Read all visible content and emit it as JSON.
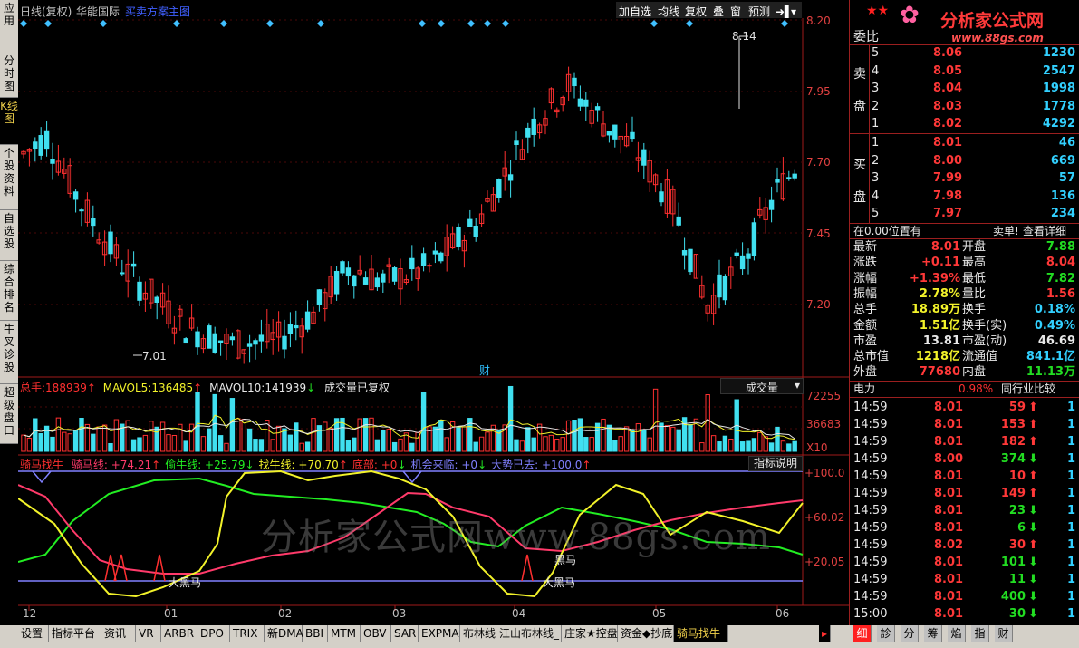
{
  "left_tabs": [
    "应用",
    "分时图",
    "K线图",
    "个股资料",
    "自选股",
    "综合排名",
    "牛叉诊股",
    "超级盘口"
  ],
  "header": {
    "period": "日线(复权)",
    "stock_name": "华能国际",
    "formula": "买卖方案主图",
    "buttons": [
      "加自选",
      "均线",
      "复权",
      "叠",
      "窗",
      "预测"
    ],
    "more_icon": "dropdown-icon"
  },
  "main_chart": {
    "y_ticks": [
      "8.20",
      "7.95",
      "7.70",
      "7.45",
      "7.20"
    ],
    "high_label": "8.14",
    "low_label": "7.01",
    "finance_marker": "财",
    "colors": {
      "up": "#ff3030",
      "down": "#40e0f0",
      "grid": "#7a1010"
    }
  },
  "volume_panel": {
    "total_label": "总手:",
    "total_value": "188939",
    "total_arrow": "↑",
    "mavol5_label": "MAVOL5:",
    "mavol5_value": "136485",
    "mavol5_arrow": "↑",
    "mavol10_label": "MAVOL10:",
    "mavol10_value": "141939",
    "mavol10_arrow": "↓",
    "note": "成交量已复权",
    "selector": "成交量",
    "y_ticks": [
      "72255",
      "36683"
    ],
    "unit": "X10"
  },
  "indicator_panel": {
    "name": "骑马找牛",
    "items": [
      {
        "label": "骑马线:",
        "value": "+74.21",
        "arrow": "↑",
        "color": "#ff3a6a"
      },
      {
        "label": "偷牛线:",
        "value": "+25.79",
        "arrow": "↓",
        "color": "#22ee22"
      },
      {
        "label": "找牛线:",
        "value": "+70.70",
        "arrow": "↑",
        "color": "#f2f22a"
      },
      {
        "label": "底部:",
        "value": "+0",
        "arrow": "↓",
        "color": "#ff3030"
      },
      {
        "label": "机会来临:",
        "value": "+0",
        "arrow": "↓",
        "color": "#8080ff"
      },
      {
        "label": "大势已去:",
        "value": "+100.0",
        "arrow": "↑",
        "color": "#8080ff"
      }
    ],
    "explain_button": "指标说明",
    "y_ticks": [
      "+100.0",
      "+60.02",
      "+20.05"
    ],
    "annotations": {
      "big_dark_horse_1": "大黑马",
      "dark_horse": "黑马",
      "big_dark_horse_2": "大黑马"
    },
    "watermark": "分析家公式网www.88gs.com"
  },
  "x_axis": [
    "12",
    "01",
    "02",
    "03",
    "04",
    "05",
    "06"
  ],
  "right_panel": {
    "brand": "分析家公式网",
    "brand_url": "www.88gs.com",
    "weibi_label": "委比",
    "sell_label": "卖盘",
    "buy_label": "买盘",
    "sell_rows": [
      {
        "level": "5",
        "price": "8.06",
        "vol": "1230"
      },
      {
        "level": "4",
        "price": "8.05",
        "vol": "2547"
      },
      {
        "level": "3",
        "price": "8.04",
        "vol": "1998"
      },
      {
        "level": "2",
        "price": "8.03",
        "vol": "1778"
      },
      {
        "level": "1",
        "price": "8.02",
        "vol": "4292"
      }
    ],
    "buy_rows": [
      {
        "level": "1",
        "price": "8.01",
        "vol": "46"
      },
      {
        "level": "2",
        "price": "8.00",
        "vol": "669"
      },
      {
        "level": "3",
        "price": "7.99",
        "vol": "57"
      },
      {
        "level": "4",
        "price": "7.98",
        "vol": "136"
      },
      {
        "level": "5",
        "price": "7.97",
        "vol": "234"
      }
    ],
    "position_text": "在0.00位置有",
    "sell_order_text": "卖单!",
    "detail_link": "查看详细",
    "quote": [
      {
        "l1": "最新",
        "v1": "8.01",
        "c1": "red",
        "l2": "开盘",
        "v2": "7.88",
        "c2": "green"
      },
      {
        "l1": "涨跌",
        "v1": "+0.11",
        "c1": "red",
        "l2": "最高",
        "v2": "8.04",
        "c2": "red"
      },
      {
        "l1": "涨幅",
        "v1": "+1.39%",
        "c1": "red",
        "l2": "最低",
        "v2": "7.82",
        "c2": "green"
      },
      {
        "l1": "振幅",
        "v1": "2.78%",
        "c1": "yel",
        "l2": "量比",
        "v2": "1.56",
        "c2": "red"
      },
      {
        "l1": "总手",
        "v1": "18.89万",
        "c1": "yel",
        "l2": "换手",
        "v2": "0.18%",
        "c2": "cyan"
      },
      {
        "l1": "金额",
        "v1": "1.51亿",
        "c1": "yel",
        "l2": "换手(实)",
        "v2": "0.49%",
        "c2": "cyan"
      },
      {
        "l1": "市盈",
        "v1": "13.81",
        "c1": "wht",
        "l2": "市盈(动)",
        "v2": "46.69",
        "c2": "wht"
      },
      {
        "l1": "总市值",
        "v1": "1218亿",
        "c1": "yel",
        "l2": "流通值",
        "v2": "841.1亿",
        "c2": "cyan"
      },
      {
        "l1": "外盘",
        "v1": "77680",
        "c1": "red",
        "l2": "内盘",
        "v2": "11.13万",
        "c2": "green"
      }
    ],
    "sector_name": "电力",
    "sector_change": "0.98%",
    "peer_compare": "同行业比较",
    "ticks": [
      {
        "time": "14:59",
        "price": "8.01",
        "vol": "59",
        "dir": "up",
        "n": "1"
      },
      {
        "time": "14:59",
        "price": "8.01",
        "vol": "153",
        "dir": "up",
        "n": "1"
      },
      {
        "time": "14:59",
        "price": "8.01",
        "vol": "182",
        "dir": "up",
        "n": "1"
      },
      {
        "time": "14:59",
        "price": "8.00",
        "vol": "374",
        "dir": "down",
        "n": "1"
      },
      {
        "time": "14:59",
        "price": "8.01",
        "vol": "10",
        "dir": "up",
        "n": "1"
      },
      {
        "time": "14:59",
        "price": "8.01",
        "vol": "149",
        "dir": "up",
        "n": "1"
      },
      {
        "time": "14:59",
        "price": "8.01",
        "vol": "23",
        "dir": "down",
        "n": "1"
      },
      {
        "time": "14:59",
        "price": "8.01",
        "vol": "6",
        "dir": "down",
        "n": "1"
      },
      {
        "time": "14:59",
        "price": "8.02",
        "vol": "30",
        "dir": "up",
        "n": "1"
      },
      {
        "time": "14:59",
        "price": "8.01",
        "vol": "101",
        "dir": "down",
        "n": "1"
      },
      {
        "time": "14:59",
        "price": "8.01",
        "vol": "11",
        "dir": "down",
        "n": "1"
      },
      {
        "time": "14:59",
        "price": "8.01",
        "vol": "400",
        "dir": "down",
        "n": "1"
      },
      {
        "time": "15:00",
        "price": "8.01",
        "vol": "30",
        "dir": "down",
        "n": "1"
      }
    ]
  },
  "bottom_tabs": [
    "设置",
    "指标平台",
    "资讯",
    "VR",
    "ARBR",
    "DPO",
    "TRIX",
    "新DMA",
    "BBI",
    "MTM",
    "OBV",
    "SAR",
    "EXPMA",
    "布林线",
    "江山布林线_",
    "庄家★控盘",
    "资金◆抄底",
    "骑马找牛"
  ],
  "bottom_tabs_active": "骑马找牛",
  "right_bottom_tabs": [
    "细",
    "診",
    "分",
    "筹",
    "焰",
    "指",
    "财"
  ],
  "right_bottom_active": "细"
}
